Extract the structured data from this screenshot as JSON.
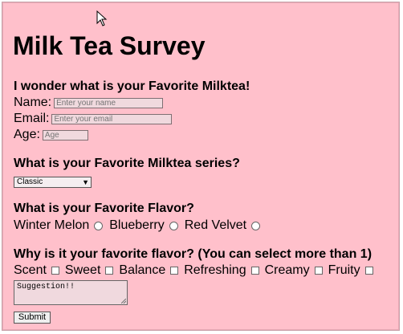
{
  "title": "Milk Tea Survey",
  "intro_question": "I wonder what is your Favorite Milktea!",
  "fields": {
    "name": {
      "label": "Name:",
      "placeholder": "Enter your name"
    },
    "email": {
      "label": "Email:",
      "placeholder": "Enter your email"
    },
    "age": {
      "label": "Age:",
      "placeholder": "Age"
    }
  },
  "series_question": "What is your Favorite Milktea series?",
  "series_select": {
    "selected": "Classic"
  },
  "flavor_question": "What is your Favorite Flavor?",
  "flavors": [
    "Winter Melon",
    "Blueberry",
    "Red Velvet"
  ],
  "reason_question": "Why is it your favorite flavor? (You can select more than 1)",
  "reasons": [
    "Scent",
    "Sweet",
    "Balance",
    "Refreshing",
    "Creamy",
    "Fruity"
  ],
  "suggestion": {
    "text": "Suggestion!!"
  },
  "submit_label": "Submit",
  "colors": {
    "background": "#ffc0cb",
    "input_bg": "#f0d9de"
  }
}
